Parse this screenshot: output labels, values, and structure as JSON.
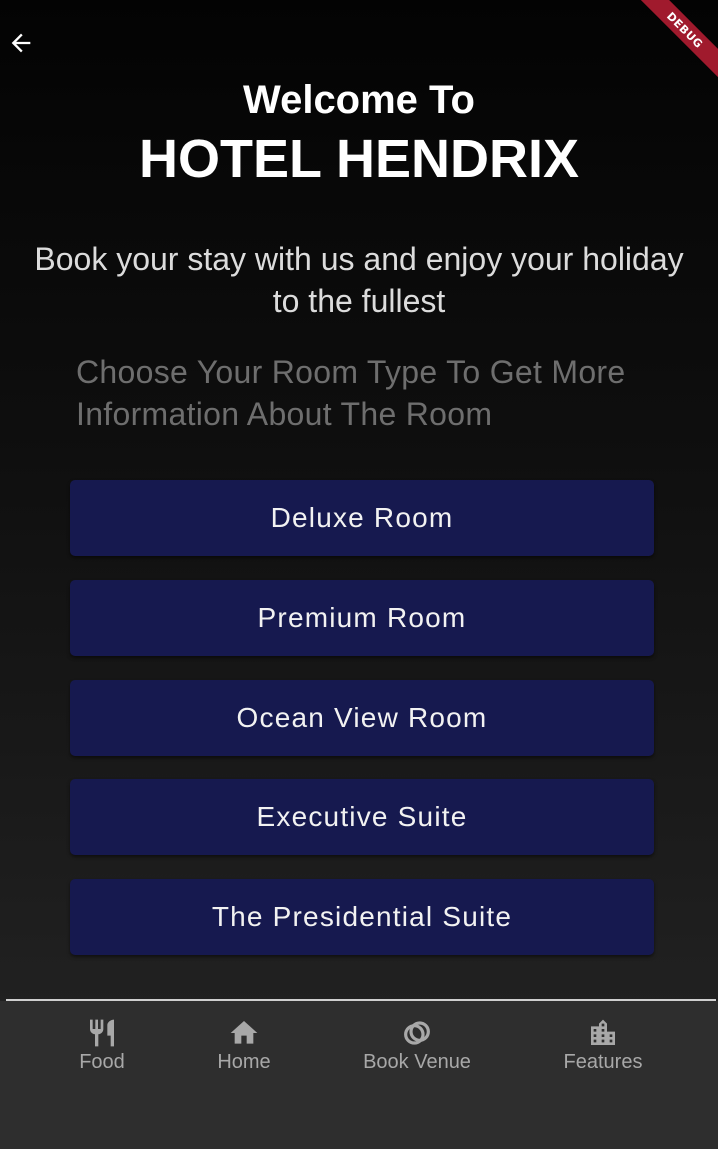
{
  "app_bar": {
    "debug_label": "DEBUG"
  },
  "header": {
    "welcome": "Welcome To",
    "hotel_name": "HOTEL HENDRIX"
  },
  "tagline": "Book your stay with us and enjoy your holiday to the fullest",
  "instruction": "Choose Your Room Type To Get More Information About The Room",
  "rooms": [
    {
      "label": "Deluxe Room"
    },
    {
      "label": "Premium Room"
    },
    {
      "label": "Ocean View Room"
    },
    {
      "label": "Executive Suite"
    },
    {
      "label": "The Presidential Suite"
    }
  ],
  "bottom_nav": [
    {
      "label": "Food",
      "icon": "restaurant-icon"
    },
    {
      "label": "Home",
      "icon": "home-icon"
    },
    {
      "label": "Book Venue",
      "icon": "rings-icon"
    },
    {
      "label": "Features",
      "icon": "building-icon"
    }
  ],
  "colors": {
    "room_button_bg": "#16194f",
    "nav_bg": "#2e2e2e",
    "nav_icon": "#a8a8a8",
    "debug_banner": "#a01a2d"
  }
}
